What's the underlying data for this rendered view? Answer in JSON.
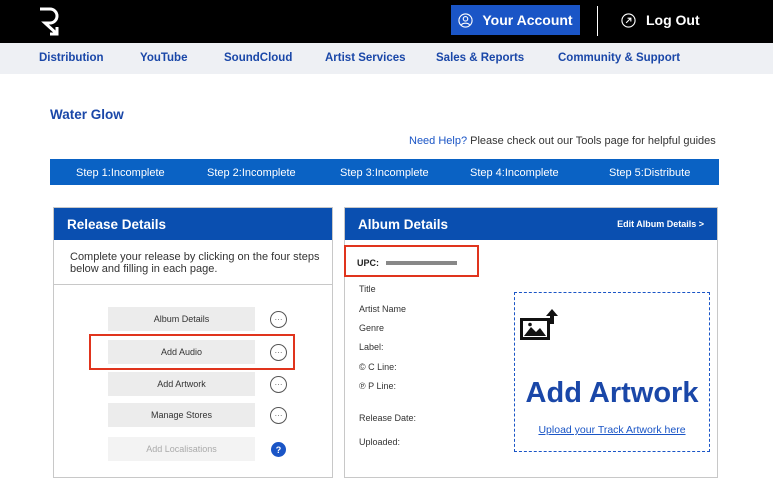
{
  "header": {
    "account_label": "Your Account",
    "logout_label": "Log Out",
    "brand_color": "#000000",
    "accent": "#1a55c6"
  },
  "nav": {
    "items": [
      "Distribution",
      "YouTube",
      "SoundCloud",
      "Artist Services",
      "Sales & Reports",
      "Community & Support"
    ]
  },
  "page": {
    "title": "Water Glow",
    "help_link": "Need Help?",
    "help_text": " Please check out our Tools page for helpful guides"
  },
  "steps": [
    "Step 1:Incomplete",
    "Step 2:Incomplete",
    "Step 3:Incomplete",
    "Step 4:Incomplete",
    "Step 5:Distribute"
  ],
  "release": {
    "title": "Release Details",
    "intro": "Complete your release by clicking on the four steps below and filling in each page.",
    "actions": [
      {
        "label": "Album Details",
        "icon": "ellipsis-circle-icon"
      },
      {
        "label": "Add Audio",
        "icon": "ellipsis-circle-icon"
      },
      {
        "label": "Add Artwork",
        "icon": "ellipsis-circle-icon"
      },
      {
        "label": "Manage Stores",
        "icon": "ellipsis-circle-icon"
      },
      {
        "label": "Add Localisations",
        "icon": "question-circle-icon",
        "disabled": true
      }
    ],
    "more_glyph": "···",
    "help_glyph": "?"
  },
  "album": {
    "title": "Album Details",
    "edit_label": "Edit Album Details  >",
    "upc_label": "UPC:",
    "fields": [
      "Title",
      "Artist Name",
      "Genre",
      "Label:",
      "© C Line:",
      "℗ P Line:",
      "Release Date:",
      "Uploaded:"
    ]
  },
  "artwork": {
    "heading": "Add Artwork",
    "link": "Upload your Track Artwork here"
  },
  "highlight_color": "#e0341d"
}
